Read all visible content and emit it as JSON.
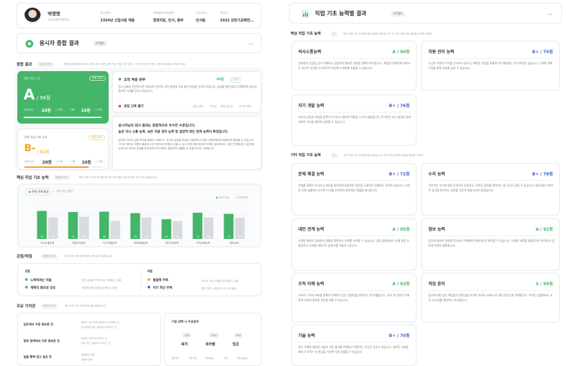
{
  "profile": {
    "name": "박명명",
    "id": "12345678912",
    "labels": [
      "응시번호",
      "지원분야/세부분야",
      "소속/부서",
      "관리자",
      "응시일"
    ],
    "values": [
      "2354년 신입사원 채용",
      "경영지원, 인사, 총무",
      "인사팀",
      "2022 상반기공채전..."
    ]
  },
  "summary": {
    "title": "응시자 종합 결과",
    "badge": "mT형수"
  },
  "overall": {
    "title": "종합 결과",
    "hint": "이해도 보기",
    "note": "종합 결과를 바탕으로 응시자의 조직 적응 능력, 핵심 직업 기초 능력, 그리고 전반적인 역량 수준과 특징을 요약해 보세요.",
    "grade": "A",
    "score": "/ 98점",
    "score_label": "적합 적응 수준",
    "pct_tag": "상위 16%",
    "rank_label": "전체 등급",
    "rank": "20등",
    "rank_total": "/ 60명",
    "tier_label": "그룹",
    "tier": "10등",
    "tier_total": "/ 23명"
  },
  "adapt": {
    "title": "조직 적응 유무",
    "score": "80점",
    "tag": "우수",
    "desc": "응시 상태가 전반적으로 안정되어 있으며, 조직 환경에 무리 없이 적응할 것으로 보입니다. 성과를 향한 태도가 명확하며 업무에 필요한 자세를 갖추고 있습니다.",
    "warn": "응답 신뢰 불가",
    "warn_tags": [
      "응답 성향",
      "극단성",
      "응답 일관성",
      "지시문 이해"
    ]
  },
  "basic": {
    "title": "전체 직업 기초 능력",
    "grade": "B-",
    "score": "/ 82점",
    "pct_tag": "상위 34%",
    "rank_label": "전체 등급",
    "rank": "20등",
    "rank_total": "/ 60명",
    "tier_label": "그룹",
    "tier": "10등",
    "tier_total": "/ 23명"
  },
  "comment": {
    "heading": "응시자님의 검사 결과는 종합적으로 우수한 수준입니다.",
    "sub": "높은 의사 소통 능력, 낮은 자원 관리 능력 및 일반적 대인 관계 능력이 특징입니다.",
    "text": "상대의 의도와 상황 맥락을 정확히 이해하고, 자신의 입장을 적절히 전달하여 다양한 이해관계자와 원활하게 협업할 수 있습니다. 그러나 업무상 자원의 배분과 시간 관리에 어려움이 있을 수 있어 이에 대한 훈련과 지원이 필요합니다. 대인 관계에서는 일반적인 수준으로 무난한 관계를 유지하며 조직 내에서 원만하게 생활할 수 있을 것으로 기대됩니다."
  },
  "core_chart": {
    "title": "핵심 직업 기초 능력",
    "hint": "이해도 보기",
    "note": "핵심 직업 기초 능력 대비 응시자 분야 평균 점수와 평균 비교 분석 결과입니다.",
    "legend": [
      "전형 전체 평균",
      "지원 직군 평균"
    ],
    "legend2": [
      "응시자 점수",
      "전형 평균"
    ]
  },
  "chart_data": {
    "type": "bar",
    "categories": [
      "의사소통능력",
      "자원관리능력",
      "자기개발능력",
      "문제해결능력",
      "대인관계능력",
      "조직이해능력",
      "정보능력"
    ],
    "series": [
      {
        "name": "응시자 점수",
        "values": [
          78,
          75,
          76,
          72,
          55,
          73,
          70
        ]
      },
      {
        "name": "전형 평균",
        "values": [
          60,
          62,
          50,
          60,
          50,
          60,
          59
        ]
      }
    ],
    "ylim": [
      0,
      100
    ],
    "bar_labels": [
      "78",
      "50",
      "76",
      "50",
      "55",
      "50",
      "59"
    ]
  },
  "strength": {
    "title": "강점/약점",
    "hint": "이해도 보기",
    "note": "응시자의 강점 및 약점에 대한 분석 결과입니다.",
    "strong_label": "강점",
    "strong": [
      {
        "name": "노력하려는 마음",
        "desc": "업무 일정을 구체적으로 수립할 수 있음"
      },
      {
        "name": "계획의 중요성 강조",
        "desc": "계획에 맞춰 일정을 관리할 수 있음"
      }
    ],
    "weak_label": "약점",
    "weak": [
      {
        "name": "통찰력 부족",
        "desc": "보고서, 도표 작성을 어려워할 수 있음"
      },
      {
        "name": "자기 혁신 부족",
        "desc": "업무 진행 시 혁신하는 데 시간 필요"
      }
    ]
  },
  "values": {
    "title": "주요 가치관",
    "hint": "이해도 보기",
    "note": "응시자의 주요 가치관에 대한 결과입니다.",
    "rows": [
      {
        "q": "업무에서 가장 중요한 것",
        "a": [
          "·정해진 시간 안에 체계적으로 일하는 것",
          "·내 성과를 다른 사람에게 보여주는 것"
        ]
      },
      {
        "q": "동료 관계에서 가장 중요한 것",
        "a": [
          "·유능한 사람으로 보이는 것",
          "·능력 있는 사람으로 보이는 것"
        ]
      },
      {
        "q": "일을 통해 얻고 싶은 것",
        "a": [
          "·경제적인 안정",
          "·사회적 공헌"
        ]
      }
    ],
    "company_title": "기업 선택 시 우선순위",
    "ranks": [
      "1st",
      "2nd",
      "3rd"
    ],
    "choices": [
      "복지",
      "워라밸",
      "임금"
    ],
    "footer": [
      "고용안정",
      "기업 비전",
      "복리후생",
      "위치",
      "직업 안정성"
    ]
  },
  "right": {
    "title": "직업 기초 능력별 결과",
    "badge": "mT형수",
    "core_title": "핵심 직업 기초 능력",
    "core_note": "핵심 직업 기초 능력에 대한 설명과 결과입니다. 각 능력 아래 세부 설명을 참고해 보세요.",
    "other_title": "기타 직업 기초 능력",
    "other_note": "기타 직업 기초 능력에 대한 결과입니다. 응시자의 잠재적 역량을 확인해 보세요."
  },
  "abilities": [
    {
      "name": "의사소통능력",
      "grade": "A / 90점",
      "desc": "상대방의 입장을 깊이 이해하고 공감하며 필요한 사항을 정확히 파악합니다. 복잡한 이해관계 속에서도 자신의 의견을 논리적으로 전달하고 대화를 조율할 수 있습니다."
    },
    {
      "name": "자원 관리 능력",
      "grade": "B+ / 75점",
      "desc": "시간과 자원의 가치를 인식하고 있으나, 제한된 자원을 효율적으로 배분하는 데 어려움이 있습니다. 구체적 계획 수립을 통해 성과를 높일 수 있습니다."
    },
    {
      "name": "자기 개발 능력",
      "grade": "B+ / 76점",
      "desc": "자신의 강점과 약점을 정확히 인식하고 필요한 역량을 스스로 개발합니다. 주기적인 자기 점검과 함께 새로운 지식을 배우며 성장할 수 있습니다."
    },
    {
      "name": "문제 해결 능력",
      "grade": "B+ / 72점",
      "desc": "문제를 정확히 인식하고 원인을 분석하며 현실적인 대안을 도출하여 실행하는 능력이 있습니다. 다양한 문제 상황에서 논리적 사고를 유지하며 창의적인 해결을 제시합니다."
    },
    {
      "name": "수리 능력",
      "grade": "B+ / 78점",
      "desc": "기본적인 수리에 대한 인지력이 부족하고, 주어진 정보를 해석하는 데 시간이 걸릴 수 있습니다. 데이터를 기반으로 업무를 판단하는 능력을 꾸준히 향상시키면 좋겠습니다."
    },
    {
      "name": "대인 관계 능력",
      "grade": "A / 95점",
      "desc": "다양한 배경의 사람들과 원활히 협력하고 관계를 유지할 수 있습니다. 갈등 상황에서도 균형 잡힌 조율자로서 신뢰를 바탕으로 팀워크를 이끌어 나갑니다."
    },
    {
      "name": "정보 능력",
      "grade": "A / 92점",
      "desc": "업무에 필요한 정보를 찾아내고 이해하며 체계적으로 관리할 수 있습니다. 다양한 자료를 효율적으로 분석하고 업무에 적절히 활용합니다."
    },
    {
      "name": "조직 이해 능력",
      "grade": "A / 93점",
      "desc": "조직의 구조와 목표를 명확히 이해하고 업무 방향성을 파악하는 데 탁월합니다. 조직 내 다양한 이해관계 속에서 중요한 판단을 내릴 수 있습니다."
    },
    {
      "name": "직업 윤리",
      "grade": "S / 99점",
      "desc": "업무에 대한 높은 책임감과 정직성을 보이며 조직과 사회의 요구를 균형 있게 이해합니다. 어려운 상황에서도 조직 내 신뢰를 형성하고 유지합니다."
    },
    {
      "name": "기술 능력",
      "grade": "B+ / 70점",
      "desc": "업무 수행에 필요한 기술의 기본 원리를 이해하고 적용하는 수준은 갖추고 있습니다. 새로운 기술을 배우고 익히는 데 관심을 가지면 더욱 성장할 수 있습니다."
    }
  ],
  "colors": {
    "green": "#45b56a",
    "blue": "#3e63c9",
    "orange": "#f2a21b",
    "red": "#e05050",
    "grey": "#d8dbe0"
  }
}
